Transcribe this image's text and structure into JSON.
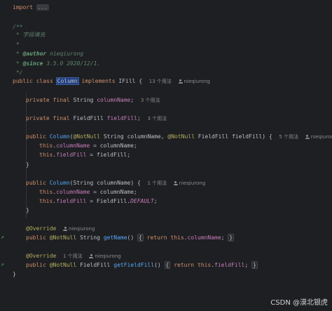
{
  "code": {
    "l1": {
      "kw": "import",
      "collapsed": "..."
    },
    "l2": {
      "text": "/**"
    },
    "l3": {
      "star": "*",
      "text": "字段填充"
    },
    "l4": {
      "star": "*"
    },
    "l5": {
      "star": "*",
      "tag": "@author",
      "text": "nieqiurong"
    },
    "l6": {
      "star": "*",
      "tag": "@since",
      "text": "3.5.0 2020/12/1."
    },
    "l7": {
      "text": "*/"
    },
    "l8": {
      "kw1": "public",
      "kw2": "class",
      "cls": "Column",
      "kw3": "implements",
      "iface": "IFill",
      "brace": "{",
      "hint_usages": "13 个用法",
      "hint_author": "nieqiurong"
    },
    "l9": {
      "kw": "private final",
      "type": "String",
      "field": "columnName",
      "semi": ";",
      "hint_usages": "3 个用法"
    },
    "l10": {
      "kw": "private final",
      "type": "FieldFill",
      "field": "fieldFill",
      "semi": ";",
      "hint_usages": "3 个用法"
    },
    "l11": {
      "kw": "public",
      "ctor": "Column",
      "open": "(",
      "ann1": "@NotNull",
      "t1": "String",
      "p1": "columnName",
      "comma": ",",
      "ann2": "@NotNull",
      "t2": "FieldFill",
      "p2": "fieldFill",
      "close": ") {",
      "hint_usages": "5 个用法",
      "hint_author": "nieqiurong"
    },
    "l12": {
      "kw": "this",
      "dot": ".",
      "field": "columnName",
      "rest": "= columnName;"
    },
    "l13": {
      "kw": "this",
      "dot": ".",
      "field": "fieldFill",
      "rest": "= fieldFill;"
    },
    "l14": {
      "text": "}"
    },
    "l15": {
      "kw": "public",
      "ctor": "Column",
      "sig": "(String columnName) {",
      "hint_usages": "1 个用法",
      "hint_author": "nieqiurong"
    },
    "l16": {
      "kw": "this",
      "dot": ".",
      "field": "columnName",
      "rest": "= columnName;"
    },
    "l17": {
      "kw": "this",
      "dot": ".",
      "field": "fieldFill",
      "rest": "= FieldFill.",
      "const": "DEFAULT",
      "semi": ";"
    },
    "l18": {
      "text": "}"
    },
    "l19": {
      "ann": "@Override",
      "hint_author": "nieqiurong"
    },
    "l20": {
      "kw": "public",
      "ann": "@NotNull",
      "type": "String",
      "method": "getName",
      "parens": "()",
      "fold_open": "{",
      "ret": "return",
      "this": "this",
      "dot": ".",
      "field": "columnName",
      "semi": ";",
      "fold_close": "}"
    },
    "l21": {
      "ann": "@Override",
      "hint_usages": "1 个用法",
      "hint_author": "nieqiurong"
    },
    "l22": {
      "kw": "public",
      "ann": "@NotNull",
      "type": "FieldFill",
      "method": "getFieldFill",
      "parens": "()",
      "fold_open": "{",
      "ret": "return",
      "this": "this",
      "dot": ".",
      "field": "fieldFill",
      "semi": ";",
      "fold_close": "}"
    },
    "l23": {
      "text": "}"
    }
  },
  "watermark": "CSDN @漠北银虎",
  "colors": {
    "background": "#1e1f22",
    "keyword": "#cf8e6d",
    "field": "#c77dbb",
    "method": "#56a8f5",
    "annotation": "#b3ae60",
    "doc": "#5f826b"
  },
  "icons": {
    "override_marker": "override-arrow-icon",
    "author": "user-icon"
  }
}
